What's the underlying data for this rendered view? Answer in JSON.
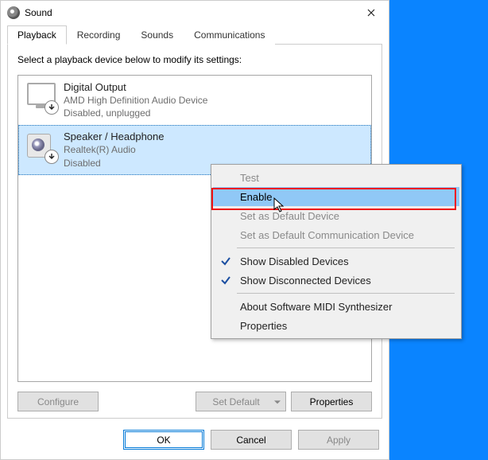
{
  "window": {
    "title": "Sound"
  },
  "tabs": [
    "Playback",
    "Recording",
    "Sounds",
    "Communications"
  ],
  "instruction": "Select a playback device below to modify its settings:",
  "devices": [
    {
      "title": "Digital Output",
      "sub1": "AMD High Definition Audio Device",
      "sub2": "Disabled, unplugged"
    },
    {
      "title": "Speaker / Headphone",
      "sub1": "Realtek(R) Audio",
      "sub2": "Disabled"
    }
  ],
  "buttons": {
    "configure": "Configure",
    "set_default": "Set Default",
    "properties": "Properties",
    "ok": "OK",
    "cancel": "Cancel",
    "apply": "Apply"
  },
  "context_menu": {
    "test": "Test",
    "enable": "Enable",
    "set_default": "Set as Default Device",
    "set_comm_default": "Set as Default Communication Device",
    "show_disabled": "Show Disabled Devices",
    "show_disconnected": "Show Disconnected Devices",
    "about_midi": "About Software MIDI Synthesizer",
    "properties": "Properties"
  }
}
